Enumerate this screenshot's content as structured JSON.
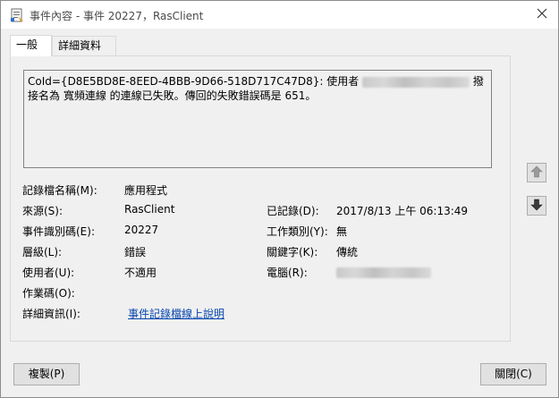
{
  "window": {
    "title": "事件內容 - 事件 20227，RasClient"
  },
  "tabs": [
    {
      "label": "一般"
    },
    {
      "label": "詳細資料"
    }
  ],
  "message": {
    "part1": "CoId={D8E5BD8E-8EED-4BBB-9D66-518D717C47D8}: 使用者",
    "part2": "撥接名為 寬頻連線 的連線已失敗。傳回的失敗錯誤碼是 651。"
  },
  "fields": {
    "log_name_label": "記錄檔名稱(M):",
    "log_name_value": "應用程式",
    "source_label": "來源(S):",
    "source_value": "RasClient",
    "logged_label": "已記錄(D):",
    "logged_value": "2017/8/13 上午 06:13:49",
    "event_id_label": "事件識別碼(E):",
    "event_id_value": "20227",
    "task_category_label": "工作類別(Y):",
    "task_category_value": "無",
    "level_label": "層級(L):",
    "level_value": "錯誤",
    "keywords_label": "關鍵字(K):",
    "keywords_value": "傳統",
    "user_label": "使用者(U):",
    "user_value": "不適用",
    "computer_label": "電腦(R):",
    "opcode_label": "作業碼(O):",
    "more_info_label": "詳細資訊(I):",
    "more_info_link": "事件記錄檔線上說明"
  },
  "buttons": {
    "copy": "複製(P)",
    "close": "關閉(C)"
  },
  "icons": {
    "title": "event-viewer-icon",
    "close": "close-icon",
    "up": "arrow-up-icon",
    "down": "arrow-down-icon"
  }
}
